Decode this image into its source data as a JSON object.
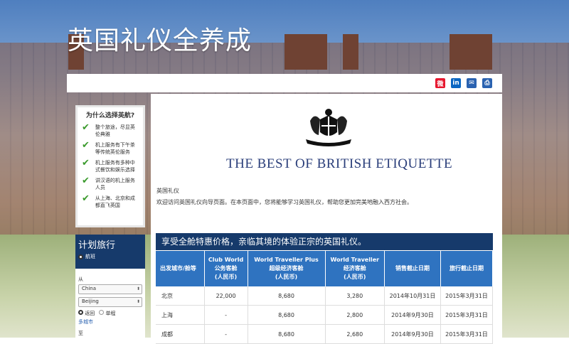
{
  "page": {
    "title": "英国礼仪全养成"
  },
  "share_icons": [
    {
      "name": "weibo-icon",
      "color": "#e6162d",
      "glyph": "微"
    },
    {
      "name": "linkedin-icon",
      "color": "#0a66c2",
      "glyph": "in"
    },
    {
      "name": "email-icon",
      "color": "#2a62b0",
      "glyph": "✉"
    },
    {
      "name": "print-icon",
      "color": "#2a62b0",
      "glyph": "⎙"
    }
  ],
  "why_box": {
    "heading": "为什么选择英航?",
    "items": [
      "整个旅途，尽显英伦典雅",
      "机上服务有下午茶等传统英伦服务",
      "机上服务有多种中式餐饮和娱乐选择",
      "讲汉语的机上服务人员",
      "从上海、北京和成都直飞英国"
    ]
  },
  "plan": {
    "title": "计划旅行",
    "flight_radio": "航班",
    "from_label": "从",
    "country_value": "China",
    "city_value": "Beijing",
    "return_label": "返回",
    "oneway_label": "单程",
    "multi_city": "多城市",
    "to_label": "至"
  },
  "main": {
    "brand": "THE BEST OF BRITISH ETIQUETTE",
    "breadcrumb": "英国礼仪",
    "intro": "欢迎访问英国礼仪向导页面。在本页面中，您将能够学习英国礼仪，帮助您更加完美地融入西方社会。",
    "banner": "享受全舱特惠价格，亲临其境的体验正宗的英国礼仪。"
  },
  "fare_table": {
    "headers": [
      [
        "出发城市/舱等"
      ],
      [
        "Club World",
        "公务客舱",
        "(人民币)"
      ],
      [
        "World Traveller Plus",
        "超级经济客舱",
        "(人民币)"
      ],
      [
        "World Traveller",
        "经济客舱",
        "(人民币)"
      ],
      [
        "销售截止日期"
      ],
      [
        "旅行截止日期"
      ]
    ],
    "rows": [
      [
        "北京",
        "22,000",
        "8,680",
        "3,280",
        "2014年10月31日",
        "2015年3月31日"
      ],
      [
        "上海",
        "-",
        "8,680",
        "2,800",
        "2014年9月30日",
        "2015年3月31日"
      ],
      [
        "成都",
        "-",
        "8,680",
        "2,680",
        "2014年9月30日",
        "2015年3月31日"
      ]
    ]
  }
}
